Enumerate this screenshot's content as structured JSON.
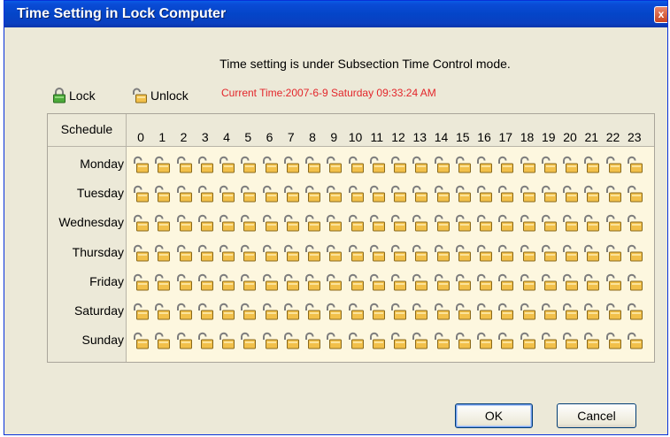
{
  "window": {
    "title": "Time Setting in Lock Computer",
    "close_label": "x"
  },
  "mode_text": "Time setting is under Subsection Time Control mode.",
  "legend": {
    "lock_label": "Lock",
    "unlock_label": "Unlock",
    "lock_icon": "locked-padlock-icon",
    "unlock_icon": "unlocked-padlock-icon"
  },
  "current_time": "Current Time:2007-6-9 Saturday 09:33:24 AM",
  "schedule": {
    "header_label": "Schedule",
    "hours": [
      "0",
      "1",
      "2",
      "3",
      "4",
      "5",
      "6",
      "7",
      "8",
      "9",
      "10",
      "11",
      "12",
      "13",
      "14",
      "15",
      "16",
      "17",
      "18",
      "19",
      "20",
      "21",
      "22",
      "23"
    ],
    "days": [
      "Monday",
      "Tuesday",
      "Wednesday",
      "Thursday",
      "Friday",
      "Saturday",
      "Sunday"
    ],
    "cell_state": "unlocked"
  },
  "buttons": {
    "ok_label": "OK",
    "cancel_label": "Cancel"
  },
  "colors": {
    "title_bar": "#0445c8",
    "current_time_text": "#e3262b",
    "grid_background": "#fdf7df",
    "window_background": "#ece9d8"
  }
}
